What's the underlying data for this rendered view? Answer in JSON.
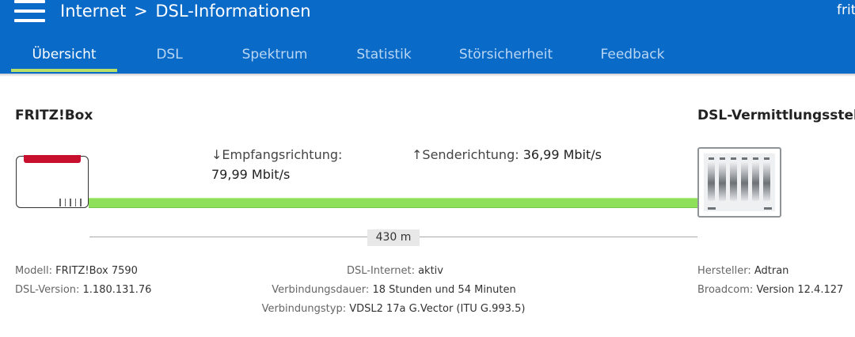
{
  "header": {
    "breadcrumb_parent": "Internet",
    "breadcrumb_separator": ">",
    "breadcrumb_current": "DSL-Informationen",
    "user_truncated": "frit",
    "accent_color": "#0a6ac8"
  },
  "tabs": [
    {
      "label": "Übersicht",
      "active": true
    },
    {
      "label": "DSL",
      "active": false
    },
    {
      "label": "Spektrum",
      "active": false
    },
    {
      "label": "Statistik",
      "active": false
    },
    {
      "label": "Störsicherheit",
      "active": false
    },
    {
      "label": "Feedback",
      "active": false
    }
  ],
  "overview": {
    "left_title": "FRITZ!Box",
    "right_title": "DSL-Vermittlungsstelle",
    "downstream_label": "↓Empfangsrichtung:",
    "downstream_value": "79,99 Mbit/s",
    "upstream_label": "↑Senderichtung:",
    "upstream_value": "36,99 Mbit/s",
    "distance": "430 m",
    "line_color": "#8ee05a"
  },
  "details": {
    "left": [
      {
        "label": "Modell:",
        "value": "FRITZ!Box 7590"
      },
      {
        "label": "DSL-Version:",
        "value": "1.180.131.76"
      }
    ],
    "center": [
      {
        "label": "DSL-Internet:",
        "value": "aktiv"
      },
      {
        "label": "Verbindungsdauer:",
        "value": "18 Stunden und 54 Minuten"
      },
      {
        "label": "Verbindungstyp:",
        "value": "VDSL2 17a G.Vector (ITU G.993.5)"
      }
    ],
    "right": [
      {
        "label": "Hersteller:",
        "value": "Adtran"
      },
      {
        "label": "Broadcom:",
        "value": "Version 12.4.127"
      }
    ]
  }
}
